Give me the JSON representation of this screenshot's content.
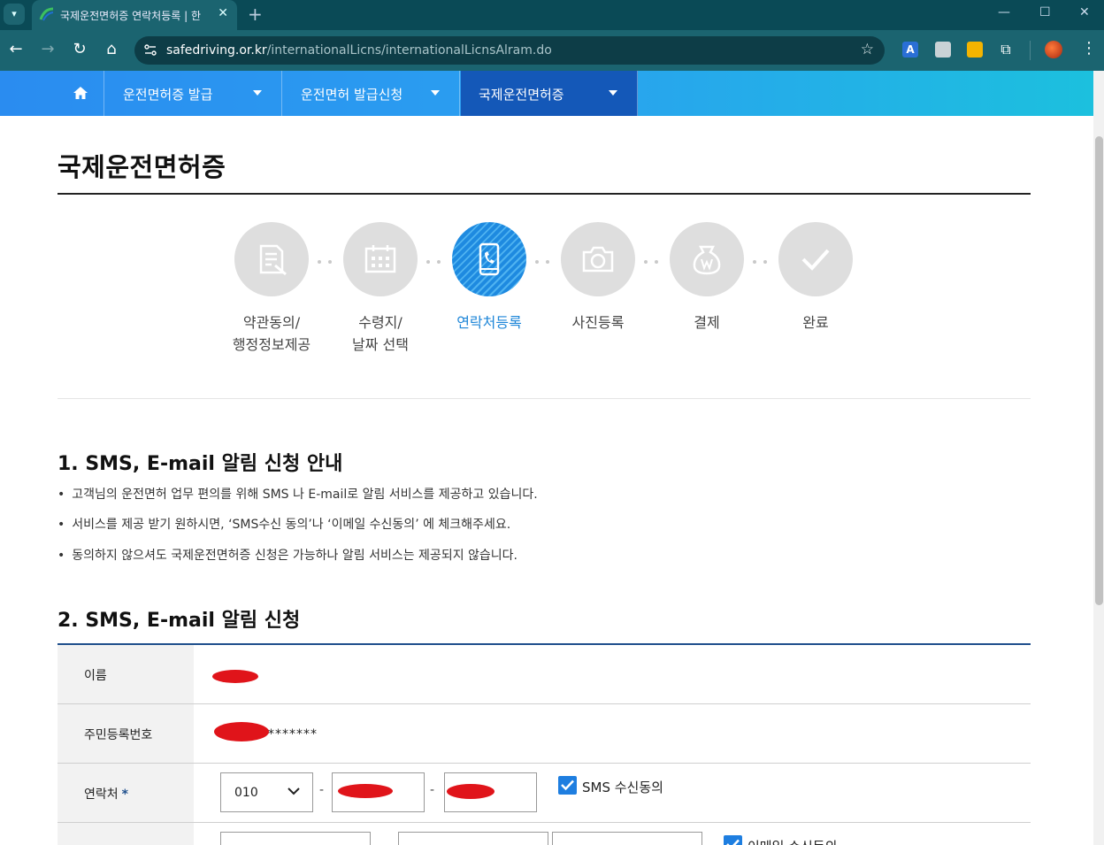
{
  "browser": {
    "tab_title": "국제운전면허증 연락처등록 | 한",
    "url_host": "safedriving.or.kr",
    "url_path": "/internationalLicns/internationalLicnsAlram.do",
    "tab_list_icon": "chevron-down-icon",
    "new_tab_icon": "plus-icon",
    "extension_a_label": "A"
  },
  "site_nav": {
    "items": [
      {
        "label": "운전면허증 발급"
      },
      {
        "label": "운전면허 발급신청"
      },
      {
        "label": "국제운전면허증"
      }
    ],
    "active_index": 2,
    "colors": {
      "active_bg": "#1458b8",
      "gradient_start": "#2a8cf0",
      "gradient_end": "#1cc0de"
    }
  },
  "page": {
    "title": "국제운전면허증"
  },
  "steps": [
    {
      "label_line1": "약관동의/",
      "label_line2": "행정정보제공",
      "icon": "document-icon"
    },
    {
      "label_line1": "수령지/",
      "label_line2": "날짜 선택",
      "icon": "calendar-icon"
    },
    {
      "label_line1": "연락처등록",
      "label_line2": "",
      "icon": "phone-icon",
      "active": true
    },
    {
      "label_line1": "사진등록",
      "label_line2": "",
      "icon": "camera-icon"
    },
    {
      "label_line1": "결제",
      "label_line2": "",
      "icon": "money-bag-icon"
    },
    {
      "label_line1": "완료",
      "label_line2": "",
      "icon": "check-icon"
    }
  ],
  "section1": {
    "title": "1. SMS, E-mail 알림 신청 안내",
    "bullets": [
      "고객님의 운전면허 업무 편의를 위해 SMS 나 E-mail로 알림 서비스를 제공하고 있습니다.",
      "서비스를 제공 받기 원하시면, ‘SMS수신 동의’나 ‘이메일 수신동의’ 에 체크해주세요.",
      "동의하지 않으셔도 국제운전면허증 신청은 가능하나 알림 서비스는 제공되지 않습니다."
    ]
  },
  "section2": {
    "title": "2. SMS, E-mail 알림 신청",
    "rows": {
      "name_label": "이름",
      "rrn_label": "주민등록번호",
      "rrn_mask": "*******",
      "phone_label": "연락처",
      "required_mark": "*",
      "phone_prefix": "010",
      "phone_dash": "-",
      "sms_consent_label": "SMS 수신동의",
      "sms_consent_checked": true,
      "email_consent_label": "이메일 수신동의",
      "email_consent_checked": true
    },
    "colors": {
      "checkbox": "#1e7ee0",
      "redaction": "#e0141a",
      "form_rule": "#1f4f8c"
    }
  }
}
